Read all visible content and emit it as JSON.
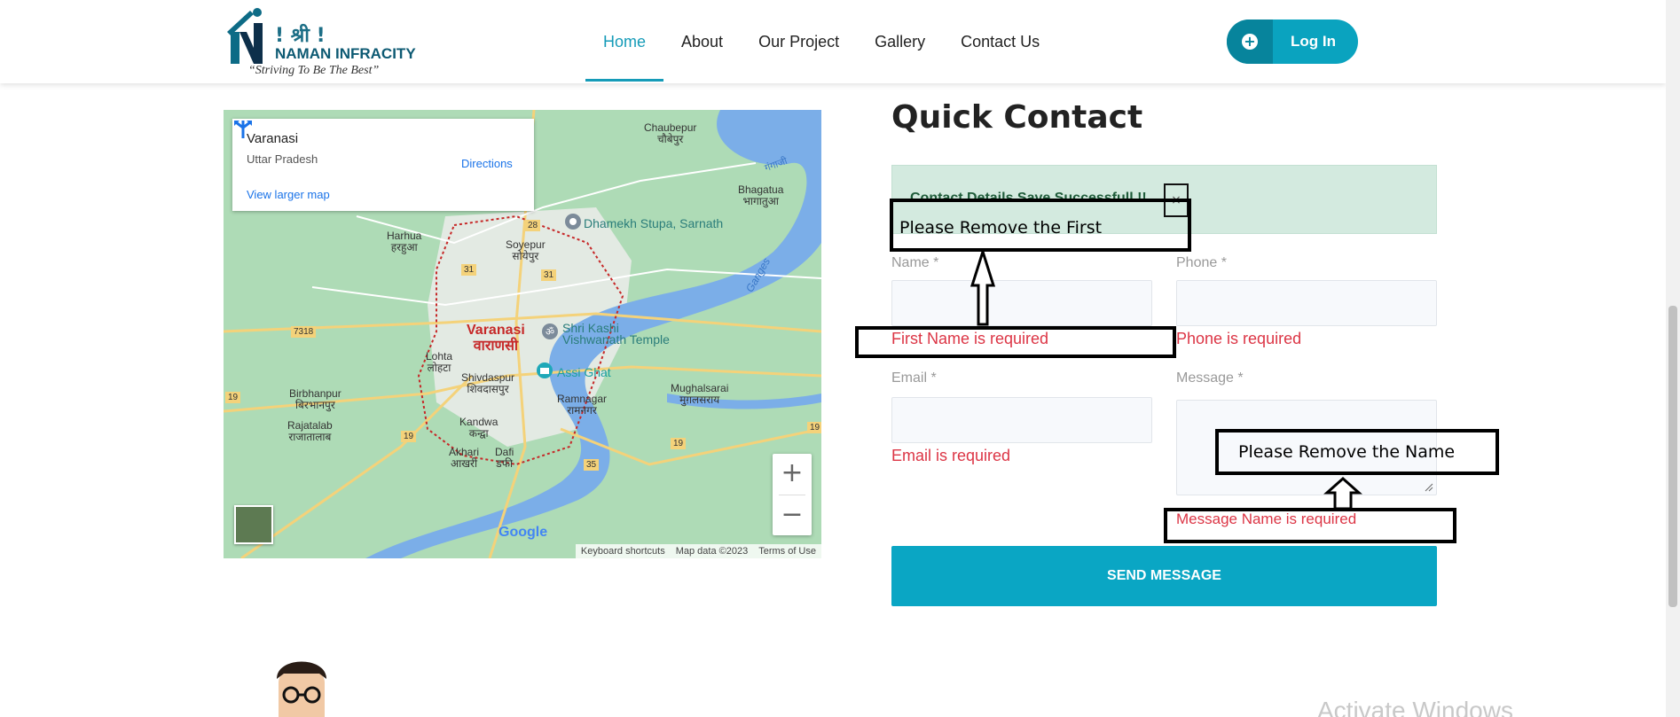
{
  "header": {
    "logo": {
      "line1": "! श्री !",
      "line2": "NAMAN INFRACITY",
      "tagline": "“Striving To Be The Best”"
    },
    "nav": [
      {
        "label": "Home",
        "active": true
      },
      {
        "label": "About",
        "active": false
      },
      {
        "label": "Our Project",
        "active": false
      },
      {
        "label": "Gallery",
        "active": false
      },
      {
        "label": "Contact Us",
        "active": false
      }
    ],
    "login_label": "Log In",
    "accent": "#0aa3bf"
  },
  "map": {
    "card_title": "Varanasi",
    "card_subtitle": "Uttar Pradesh",
    "view_larger": "View larger map",
    "directions": "Directions",
    "places": {
      "city_en": "Varanasi",
      "city_hi": "वाराणसी",
      "chaubepur": "Chaubepur",
      "chaubepur_hi": "चौबेपुर",
      "bhagatua": "Bhagatua",
      "bhagatua_hi": "भागातुआ",
      "harhua": "Harhua",
      "harhua_hi": "हरहुआ",
      "soyepur": "Soyepur",
      "soyepur_hi": "सोयेपुर",
      "dhamekh": "Dhamekh Stupa, Sarnath",
      "kashi": "Shri Kashi",
      "vishwanath": "Vishwanath Temple",
      "assi": "Assi Ghat",
      "lohta": "Lohta",
      "lohta_hi": "लोहटा",
      "shivdaspur": "Shivdaspur",
      "shivdaspur_hi": "शिवदासपुर",
      "birbhanpur": "Birbhanpur",
      "birbhanpur_hi": "बिरभानपुर",
      "rajatalab": "Rajatalab",
      "rajatalab_hi": "राजातालाब",
      "kandwa": "Kandwa",
      "kandwa_hi": "कन्द्वा",
      "akhari": "Akhari",
      "akhari_hi": "आखरी",
      "dafi": "Dafi",
      "dafi_hi": "डफी",
      "ramnagar": "Ramnagar",
      "ramnagar_hi": "रामनगर",
      "mughalsarai": "Mughalsarai",
      "mughalsarai_hi": "मुग़लसराय",
      "ganges": "Ganges",
      "ganges_hi": "गंगाजी"
    },
    "road_numbers": [
      "28",
      "31",
      "31",
      "7318",
      "19",
      "19",
      "19",
      "19",
      "35"
    ],
    "google": "Google",
    "footer": [
      "Keyboard shortcuts",
      "Map data ©2023",
      "Terms of Use"
    ],
    "zoom_in": "+",
    "zoom_out": "−"
  },
  "contact": {
    "title": "Quick Contact",
    "alert_text": "Contact Details Save Successfull !!",
    "alert_close": "×",
    "fields": {
      "name_label": "Name *",
      "phone_label": "Phone *",
      "email_label": "Email *",
      "message_label": "Message *"
    },
    "errors": {
      "name": "First Name is required",
      "phone": "Phone is required",
      "email": "Email is required",
      "message": "Message Name is required"
    },
    "send_label": "SEND MESSAGE",
    "accent": "#0aa6c4",
    "error_color": "#dc3545"
  },
  "annotations": {
    "remove_first": "Please Remove the First",
    "remove_name": "Please Remove the Name"
  },
  "watermark": "Activate Windows"
}
